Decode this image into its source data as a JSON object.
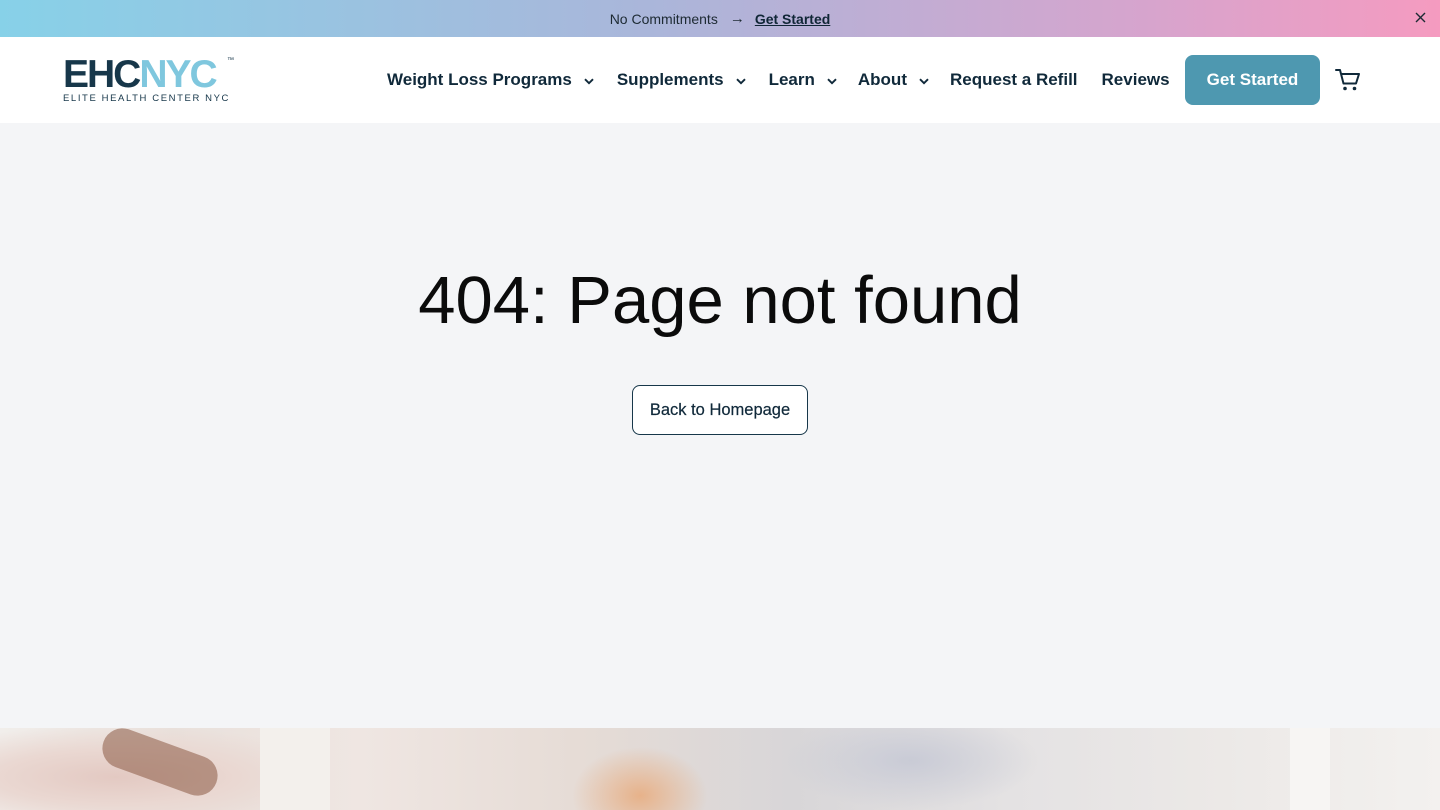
{
  "announcement": {
    "text": "No Commitments",
    "arrow": "→",
    "link_label": "Get Started",
    "close_icon": "close-icon"
  },
  "header": {
    "logo": {
      "mark_primary": "EHC",
      "mark_accent": "NYC",
      "trademark": "™",
      "tagline": "ELITE HEALTH CENTER NYC"
    },
    "nav": [
      {
        "label": "Weight Loss Programs",
        "has_dropdown": true
      },
      {
        "label": "Supplements",
        "has_dropdown": true
      },
      {
        "label": "Learn",
        "has_dropdown": true
      },
      {
        "label": "About",
        "has_dropdown": true
      },
      {
        "label": "Request a Refill",
        "has_dropdown": false
      },
      {
        "label": "Reviews",
        "has_dropdown": false
      }
    ],
    "cta_label": "Get Started",
    "cart_icon": "shopping-cart-icon"
  },
  "main": {
    "title": "404: Page not found",
    "back_button_label": "Back to Homepage"
  },
  "colors": {
    "brand_dark": "#17374a",
    "brand_accent": "#7fc7de",
    "cta_background": "#4e98b0",
    "page_background": "#f4f5f7"
  }
}
